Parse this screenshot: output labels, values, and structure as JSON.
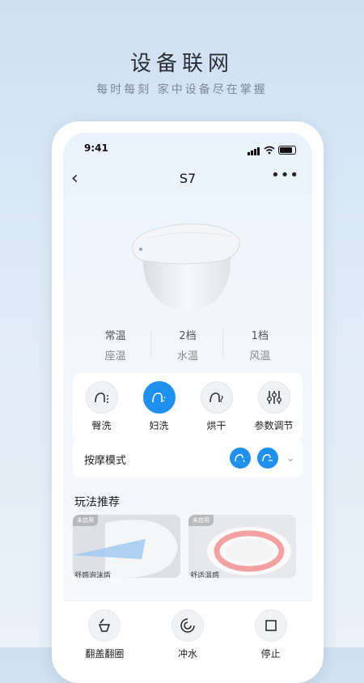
{
  "promo": {
    "headline": "设备联网",
    "subline": "每时每刻  家中设备尽在掌握"
  },
  "status_bar": {
    "time": "9:41"
  },
  "nav": {
    "title": "S7"
  },
  "stats": [
    {
      "value": "常温",
      "label": "座温"
    },
    {
      "value": "2档",
      "label": "水温"
    },
    {
      "value": "1档",
      "label": "风温"
    }
  ],
  "functions": [
    {
      "label": "臀洗",
      "icon": "rear-wash-icon",
      "active": false
    },
    {
      "label": "妇洗",
      "icon": "feminine-wash-icon",
      "active": true
    },
    {
      "label": "烘干",
      "icon": "dry-icon",
      "active": false
    },
    {
      "label": "参数调节",
      "icon": "sliders-icon",
      "active": false
    }
  ],
  "massage": {
    "label": "按摩模式"
  },
  "recommend": {
    "title": "玩法推荐",
    "cards": [
      {
        "tag": "未启用",
        "title": "舒感泡沫盾"
      },
      {
        "tag": "未启用",
        "title": "舒适温感"
      }
    ]
  },
  "bottom_bar": [
    {
      "label": "翻盖翻圈",
      "icon": "lid-flip-icon"
    },
    {
      "label": "冲水",
      "icon": "flush-icon"
    },
    {
      "label": "停止",
      "icon": "stop-icon"
    }
  ],
  "colors": {
    "accent": "#1f8ff0",
    "background_top": "#cfe0f2"
  }
}
